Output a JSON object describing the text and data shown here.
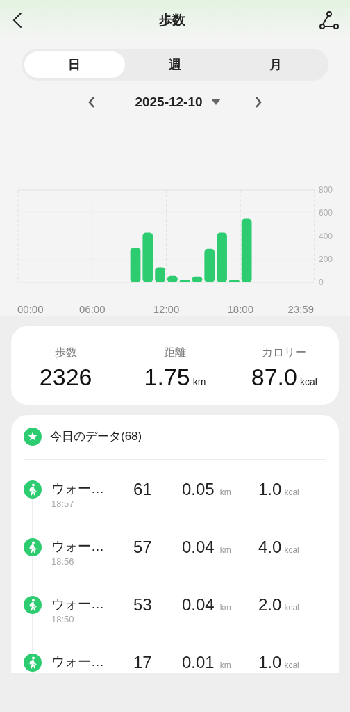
{
  "header": {
    "title": "歩数"
  },
  "tabs": [
    {
      "label": "日",
      "selected": true
    },
    {
      "label": "週",
      "selected": false
    },
    {
      "label": "月",
      "selected": false
    }
  ],
  "date": "2025-12-10",
  "chart_data": {
    "type": "bar",
    "x": [
      9.5,
      10.5,
      11.5,
      12.5,
      13.5,
      14.5,
      15.5,
      16.5,
      17.5,
      18.5
    ],
    "xlim": [
      0,
      24
    ],
    "grid": true,
    "values": [
      300,
      430,
      130,
      55,
      20,
      50,
      290,
      430,
      20,
      550
    ],
    "ylim": [
      0,
      800
    ],
    "yticks": [
      0,
      200,
      400,
      600,
      800
    ],
    "xticks": [
      {
        "value": 0,
        "label": "00:00"
      },
      {
        "value": 6,
        "label": "06:00"
      },
      {
        "value": 12,
        "label": "12:00"
      },
      {
        "value": 18,
        "label": "18:00"
      },
      {
        "value": 23.983,
        "label": "23:59"
      }
    ]
  },
  "summary": [
    {
      "label": "歩数",
      "value": "2326"
    },
    {
      "label": "距離",
      "value": "1.75",
      "unit": "km"
    },
    {
      "label": "カロリー",
      "value": "87.0",
      "unit": "kcal"
    }
  ],
  "records": {
    "title": "今日のデータ(68)",
    "items": [
      {
        "name": "ウォー…",
        "time": "18:57",
        "steps": "61",
        "distance": "0.05",
        "distance_unit": "km",
        "calories": "1.0",
        "calories_unit": "kcal"
      },
      {
        "name": "ウォー…",
        "time": "18:56",
        "steps": "57",
        "distance": "0.04",
        "distance_unit": "km",
        "calories": "4.0",
        "calories_unit": "kcal"
      },
      {
        "name": "ウォー…",
        "time": "18:50",
        "steps": "53",
        "distance": "0.04",
        "distance_unit": "km",
        "calories": "2.0",
        "calories_unit": "kcal"
      },
      {
        "name": "ウォー…",
        "steps": "17",
        "distance": "0.01",
        "distance_unit": "km",
        "calories": "1.0",
        "calories_unit": "kcal"
      }
    ]
  }
}
